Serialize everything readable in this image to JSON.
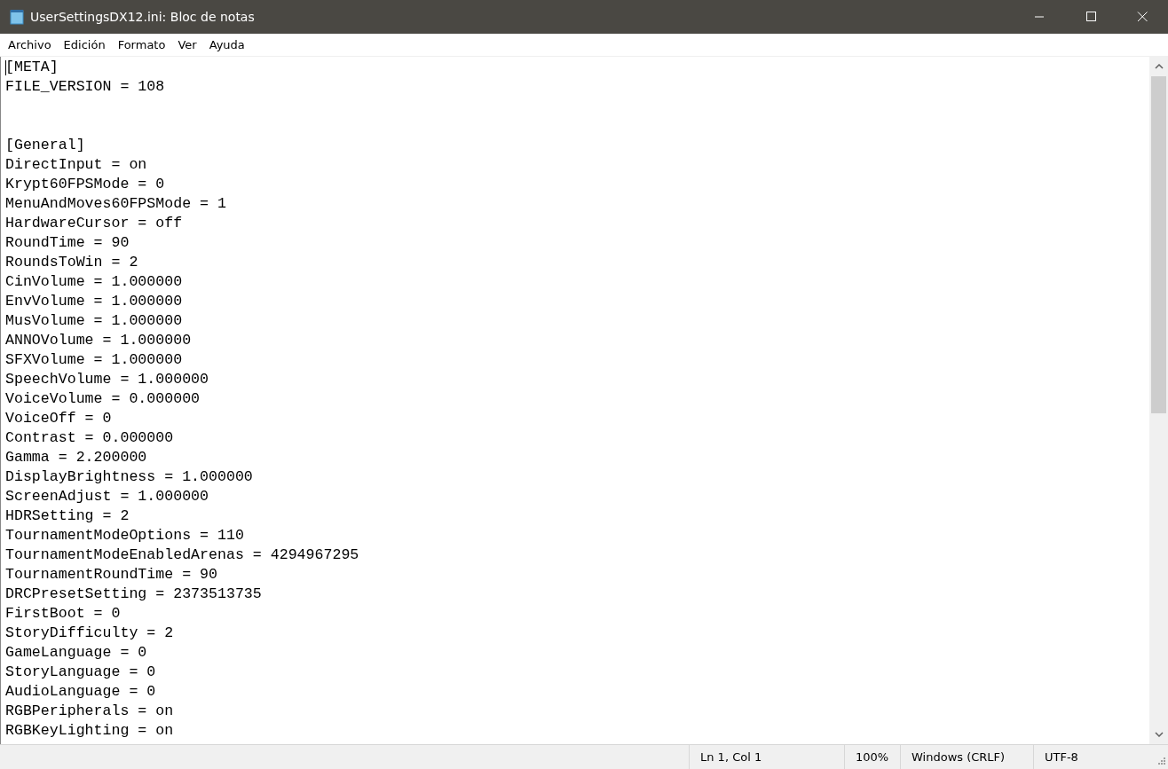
{
  "window": {
    "title": "UserSettingsDX12.ini: Bloc de notas"
  },
  "menu": [
    "Archivo",
    "Edición",
    "Formato",
    "Ver",
    "Ayuda"
  ],
  "editor": {
    "caret_visible": true,
    "lines": [
      {
        "kind": "line",
        "text": "[META]"
      },
      {
        "kind": "line",
        "text": "FILE_VERSION = 108"
      },
      {
        "kind": "blank"
      },
      {
        "kind": "blank"
      },
      {
        "kind": "line",
        "text": "[General]"
      },
      {
        "kind": "line",
        "text": "DirectInput = on"
      },
      {
        "kind": "line",
        "text": "Krypt60FPSMode = 0"
      },
      {
        "kind": "line",
        "text": "MenuAndMoves60FPSMode = 1"
      },
      {
        "kind": "line",
        "text": "HardwareCursor = off"
      },
      {
        "kind": "line",
        "text": "RoundTime = 90"
      },
      {
        "kind": "line",
        "text": "RoundsToWin = 2"
      },
      {
        "kind": "line",
        "text": "CinVolume = 1.000000"
      },
      {
        "kind": "line",
        "text": "EnvVolume = 1.000000"
      },
      {
        "kind": "line",
        "text": "MusVolume = 1.000000"
      },
      {
        "kind": "line",
        "text": "ANNOVolume = 1.000000"
      },
      {
        "kind": "line",
        "text": "SFXVolume = 1.000000"
      },
      {
        "kind": "line",
        "text": "SpeechVolume = 1.000000"
      },
      {
        "kind": "line",
        "text": "VoiceVolume = 0.000000"
      },
      {
        "kind": "line",
        "text": "VoiceOff = 0"
      },
      {
        "kind": "line",
        "text": "Contrast = 0.000000"
      },
      {
        "kind": "line",
        "text": "Gamma = 2.200000"
      },
      {
        "kind": "line",
        "text": "DisplayBrightness = 1.000000"
      },
      {
        "kind": "line",
        "text": "ScreenAdjust = 1.000000"
      },
      {
        "kind": "line",
        "text": "HDRSetting = 2"
      },
      {
        "kind": "line",
        "text": "TournamentModeOptions = 110"
      },
      {
        "kind": "line",
        "text": "TournamentModeEnabledArenas = 4294967295"
      },
      {
        "kind": "line",
        "text": "TournamentRoundTime = 90"
      },
      {
        "kind": "line",
        "text": "DRCPresetSetting = 2373513735"
      },
      {
        "kind": "line",
        "text": "FirstBoot = 0"
      },
      {
        "kind": "line",
        "text": "StoryDifficulty = 2"
      },
      {
        "kind": "line",
        "text": "GameLanguage = 0"
      },
      {
        "kind": "line",
        "text": "StoryLanguage = 0"
      },
      {
        "kind": "line",
        "text": "AudioLanguage = 0"
      },
      {
        "kind": "line",
        "text": "RGBPeripherals = on"
      },
      {
        "kind": "line",
        "text": "RGBKeyLighting = on"
      }
    ]
  },
  "status_bar": {
    "position": "Ln 1, Col 1",
    "zoom": "100%",
    "line_endings": "Windows (CRLF)",
    "encoding": "UTF-8"
  }
}
